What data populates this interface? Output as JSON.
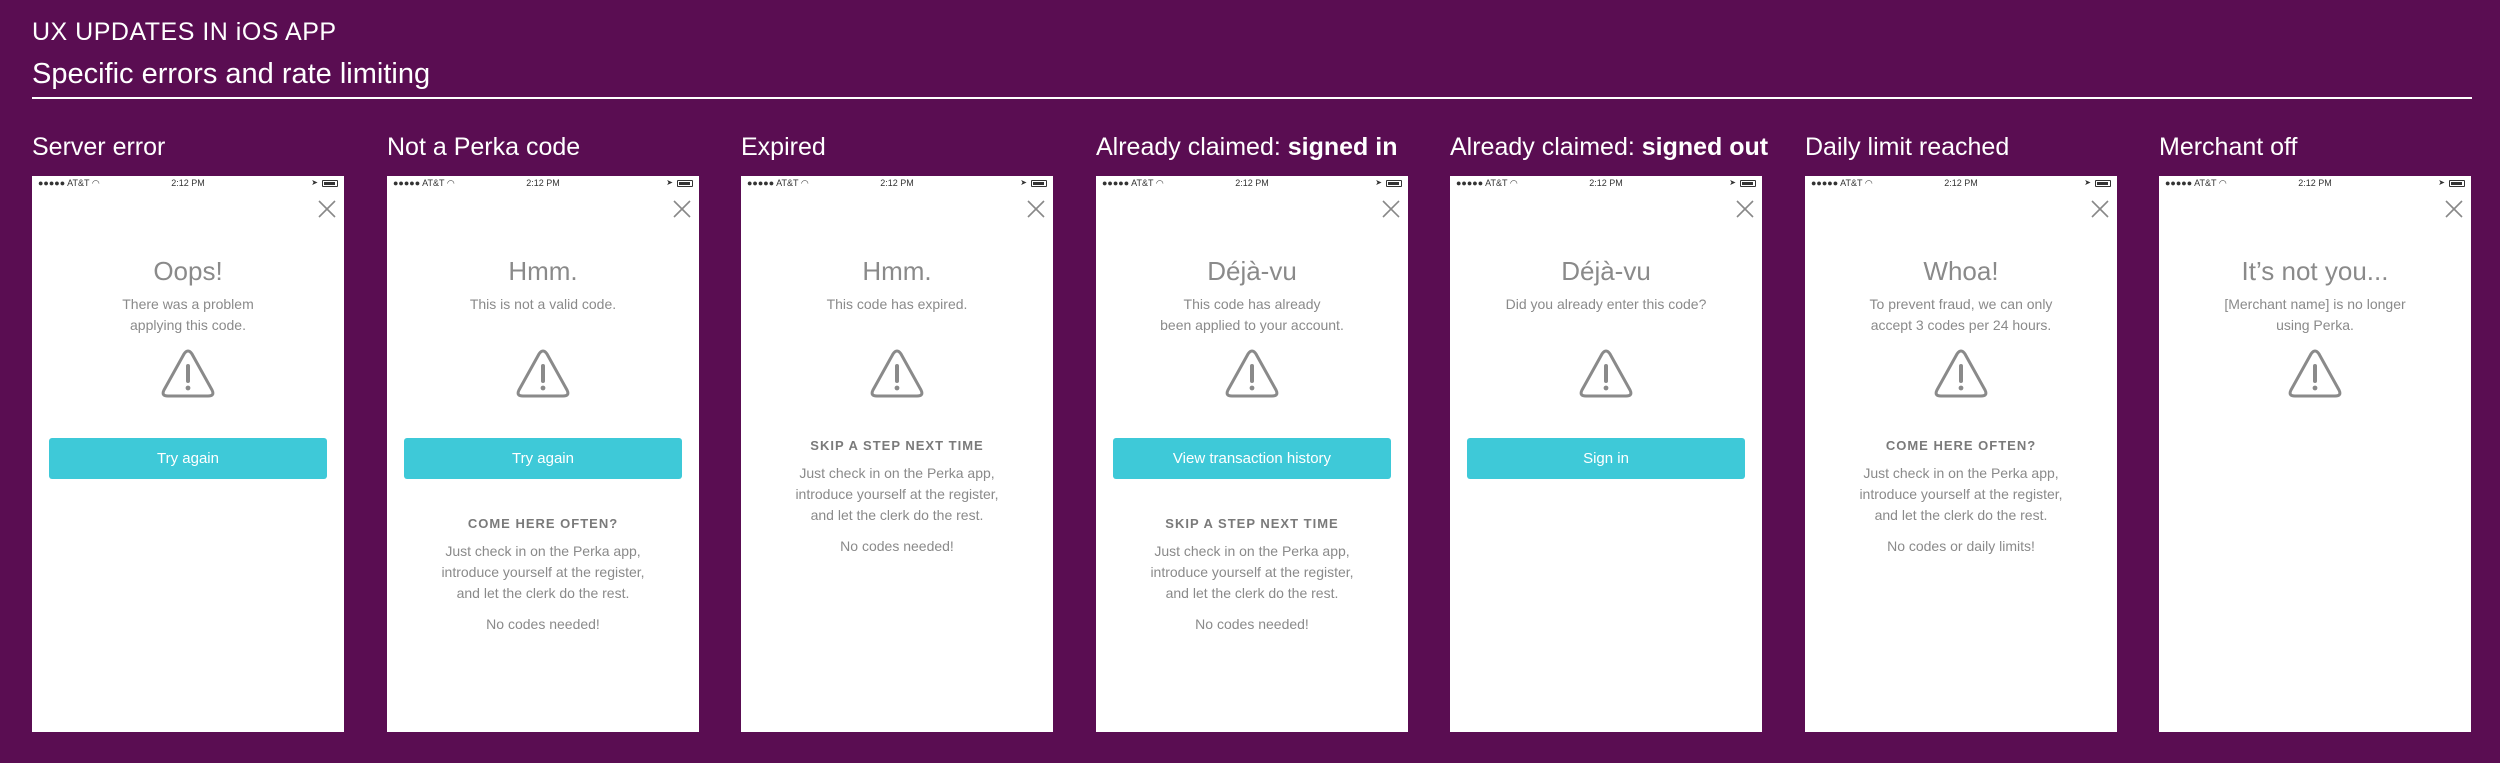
{
  "header": {
    "title": "UX UPDATES IN iOS APP",
    "subtitle": "Specific errors and rate limiting"
  },
  "statusbar": {
    "carrier": "●●●●● AT&T",
    "time": "2:12 PM"
  },
  "colors": {
    "background": "#5a0d52",
    "button": "#3ec9d8",
    "text": "#8a8a8a"
  },
  "panels": [
    {
      "label": "Server error",
      "label_bold": "",
      "heading": "Oops!",
      "sub": "There was a problem\napplying this code.",
      "button": "Try again"
    },
    {
      "label": "Not a Perka code",
      "label_bold": "",
      "heading": "Hmm.",
      "sub": "This is not a valid code.",
      "button": "Try again",
      "promo_title": "COME HERE OFTEN?",
      "promo_body": "Just check in on the Perka app,\nintroduce yourself at the register,\nand let the clerk do the rest.",
      "promo_foot": "No codes needed!"
    },
    {
      "label": "Expired",
      "label_bold": "",
      "heading": "Hmm.",
      "sub": "This code has expired.",
      "promo_title": "SKIP A STEP NEXT TIME",
      "promo_body": "Just check in on the Perka app,\nintroduce yourself at the register,\nand let the clerk do the rest.",
      "promo_foot": "No codes needed!"
    },
    {
      "label": "Already claimed: ",
      "label_bold": "signed in",
      "heading": "Déjà-vu",
      "sub": "This code has already\nbeen applied to your account.",
      "button": "View transaction history",
      "promo_title": "SKIP A STEP NEXT TIME",
      "promo_body": "Just check in on the Perka app,\nintroduce yourself at the register,\nand let the clerk do the rest.",
      "promo_foot": "No codes needed!"
    },
    {
      "label": "Already claimed: ",
      "label_bold": "signed out",
      "heading": "Déjà-vu",
      "sub": "Did you already enter this code?",
      "button": "Sign in"
    },
    {
      "label": "Daily limit reached",
      "label_bold": "",
      "heading": "Whoa!",
      "sub": "To prevent fraud, we can only\naccept 3 codes per 24 hours.",
      "promo_title": "COME HERE OFTEN?",
      "promo_body": "Just check in on the Perka app,\nintroduce yourself at the register,\nand let the clerk do the rest.",
      "promo_foot": "No codes or daily limits!"
    },
    {
      "label": "Merchant off",
      "label_bold": "",
      "heading": "It’s not you...",
      "sub": "[Merchant name] is no longer\nusing Perka."
    }
  ]
}
